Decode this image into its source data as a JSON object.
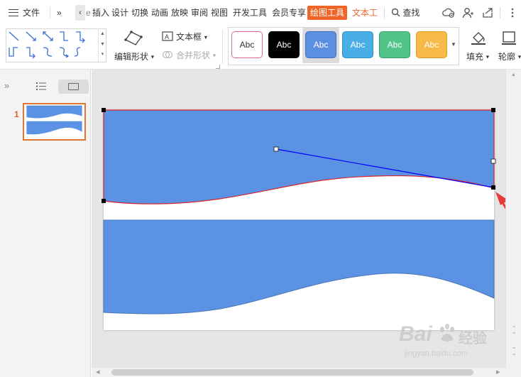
{
  "menubar": {
    "file": "文件",
    "expand": "»",
    "tab_scroll_left": "‹",
    "tabs": [
      "插入",
      "设计",
      "切换",
      "动画",
      "放映",
      "审阅",
      "视图",
      "开发工具",
      "会员专享"
    ],
    "partial_tab": "e",
    "drawing_tools": "绘图工具",
    "text_tools": "文本工",
    "search": "查找"
  },
  "ribbon": {
    "edit_shape": "编辑形状",
    "textbox": "文本框",
    "merge_shapes": "合并形状",
    "style_label": "Abc",
    "styles": [
      {
        "fill": "#ffffff",
        "border": "#e06a86",
        "text": "#333333"
      },
      {
        "fill": "#000000",
        "border": "#000000",
        "text": "#ffffff"
      },
      {
        "fill": "#5b8fe0",
        "border": "#3d6cc0",
        "text": "#ffffff",
        "selected": true
      },
      {
        "fill": "#4aaee6",
        "border": "#2d8cc4",
        "text": "#ffffff"
      },
      {
        "fill": "#52c48a",
        "border": "#34a36a",
        "text": "#ffffff"
      },
      {
        "fill": "#f7b947",
        "border": "#db9a24",
        "text": "#ffffff"
      }
    ],
    "fill": "填充",
    "outline": "轮廓"
  },
  "sidebar": {
    "collapse": "»",
    "slide_number": "1"
  },
  "colors": {
    "shape_fill": "#5b92e4",
    "selection_outline": "#d9242a",
    "bezier_handle_line": "#0000ff",
    "accent_orange": "#f0662a",
    "arrow": "#e63b3b"
  },
  "watermark": {
    "brand": "Bai",
    "brand_cn": "经验",
    "url": "jingyan.baidu.com"
  }
}
